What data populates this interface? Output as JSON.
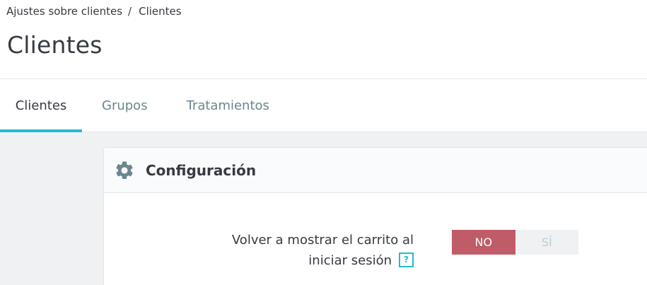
{
  "breadcrumb": {
    "parent": "Ajustes sobre clientes",
    "separator": "/",
    "current": "Clientes"
  },
  "page": {
    "title": "Clientes"
  },
  "tabs": [
    {
      "label": "Clientes",
      "active": true
    },
    {
      "label": "Grupos",
      "active": false
    },
    {
      "label": "Tratamientos",
      "active": false
    }
  ],
  "card": {
    "title": "Configuración",
    "icon": "gear-icon"
  },
  "form": {
    "label_line1": "Volver a mostrar el carrito al",
    "label_line2": "iniciar sesión",
    "help_glyph": "?",
    "switch": {
      "no_label": "NO",
      "yes_label": "SÍ",
      "selected": "NO"
    }
  },
  "colors": {
    "accent": "#25b9d7",
    "switch_off": "#c05c67",
    "text": "#363a41",
    "muted": "#6c868e"
  }
}
